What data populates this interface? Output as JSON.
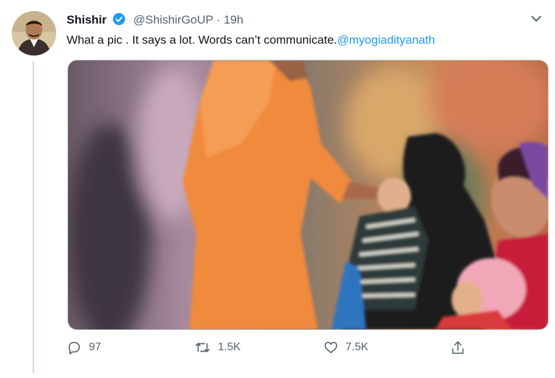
{
  "tweet": {
    "display_name": "Shishir",
    "handle": "@ShishirGoUP",
    "separator": "·",
    "time": "19h",
    "text": "What a pic . It says a lot. Words can’t communicate.",
    "mention": "@myogiadityanath"
  },
  "actions": {
    "replies": "97",
    "retweets": "1.5K",
    "likes": "7.5K"
  },
  "colors": {
    "accent": "#1d9bf0",
    "secondary_text": "#536471",
    "robe": "#f08a3c"
  },
  "icons": [
    "verified-badge-icon",
    "chevron-down-icon",
    "reply-icon",
    "retweet-icon",
    "like-icon",
    "share-icon"
  ]
}
